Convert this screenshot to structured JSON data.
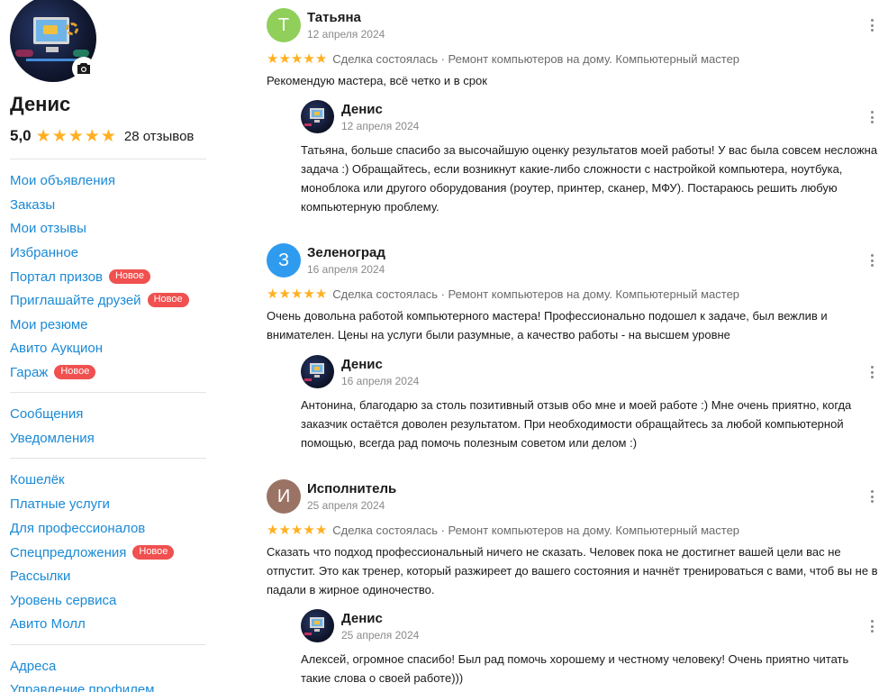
{
  "profile": {
    "name": "Денис",
    "rating": "5,0",
    "reviews_count": "28 отзывов",
    "star_color": "#ffb021"
  },
  "menu": {
    "group1": [
      {
        "label": "Мои объявления",
        "badge": ""
      },
      {
        "label": "Заказы",
        "badge": ""
      },
      {
        "label": "Мои отзывы",
        "badge": ""
      },
      {
        "label": "Избранное",
        "badge": ""
      },
      {
        "label": "Портал призов",
        "badge": "Новое"
      },
      {
        "label": "Приглашайте друзей",
        "badge": "Новое"
      },
      {
        "label": "Мои резюме",
        "badge": ""
      },
      {
        "label": "Авито Аукцион",
        "badge": ""
      },
      {
        "label": "Гараж",
        "badge": "Новое"
      }
    ],
    "group2": [
      {
        "label": "Сообщения",
        "badge": ""
      },
      {
        "label": "Уведомления",
        "badge": ""
      }
    ],
    "group3": [
      {
        "label": "Кошелёк",
        "badge": ""
      },
      {
        "label": "Платные услуги",
        "badge": ""
      },
      {
        "label": "Для профессионалов",
        "badge": ""
      },
      {
        "label": "Спецпредложения",
        "badge": "Новое"
      },
      {
        "label": "Рассылки",
        "badge": ""
      },
      {
        "label": "Уровень сервиса",
        "badge": ""
      },
      {
        "label": "Авито Молл",
        "badge": ""
      }
    ],
    "group4": [
      {
        "label": "Адреса",
        "badge": ""
      },
      {
        "label": "Управление профилем",
        "badge": ""
      }
    ]
  },
  "colors": {
    "link": "#1a8ad6",
    "badge": "#f0504f",
    "avatar_t": "#8fcf5a",
    "avatar_z": "#2f9bef",
    "avatar_i": "#9a7365"
  },
  "reviews": [
    {
      "initial": "Т",
      "author": "Татьяна",
      "date": "12 апреля 2024",
      "rating": 5,
      "deal": "Сделка состоялась · Ремонт компьютеров на дому. Компьютерный мастер",
      "text": "Рекомендую мастера, всё четко и в срок",
      "reply": {
        "author": "Денис",
        "date": "12 апреля 2024",
        "text": "Татьяна, больше спасибо за высочайшую оценку результатов моей работы! У вас была совсем несложна задача :) Обращайтесь, если возникнут какие-либо сложности с настройкой компьютера, ноутбука, моноблока или другого оборудования (роутер, принтер, сканер, МФУ). Постараюсь решить любую компьютерную проблему."
      }
    },
    {
      "initial": "З",
      "author": "Зеленоград",
      "date": "16 апреля 2024",
      "rating": 5,
      "deal": "Сделка состоялась · Ремонт компьютеров на дому. Компьютерный мастер",
      "text": "Очень довольна работой компьютерного мастера! Профессионально подошел к задаче, был вежлив и внимателен. Цены на услуги были разумные, а качество работы - на высшем уровне",
      "reply": {
        "author": "Денис",
        "date": "16 апреля 2024",
        "text": "Антонина, благодарю за столь позитивный отзыв обо мне и моей работе :) Мне очень приятно, когда заказчик остаётся доволен результатом. При необходимости обращайтесь за любой компьютерной помощью, всегда рад помочь полезным советом или делом :)"
      }
    },
    {
      "initial": "И",
      "author": "Исполнитель",
      "date": "25 апреля 2024",
      "rating": 5,
      "deal": "Сделка состоялась · Ремонт компьютеров на дому. Компьютерный мастер",
      "text": "Сказать что подход профессиональный ничего не сказать. Человек пока не достигнет вашей цели вас не отпустит. Это как тренер, который разжиреет до вашего состояния и начнёт тренироваться с вами, чтоб вы не в падали в жирное одиночество.",
      "reply": {
        "author": "Денис",
        "date": "25 апреля 2024",
        "text": "Алексей, огромное спасибо! Был рад помочь хорошему и честному человеку! Очень приятно читать такие слова о своей работе)))"
      }
    }
  ]
}
